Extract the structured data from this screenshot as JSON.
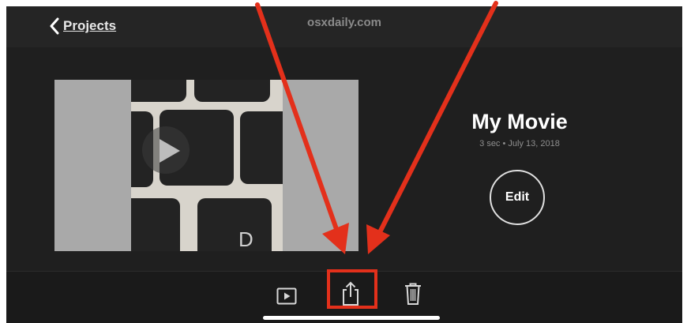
{
  "header": {
    "back_label": "Projects",
    "site": "osxdaily.com"
  },
  "project": {
    "title": "My Movie",
    "meta": "3 sec • July 13, 2018",
    "edit_label": "Edit",
    "thumbnail_keys": [
      "D"
    ]
  },
  "toolbar": {
    "items": [
      {
        "name": "play-icon"
      },
      {
        "name": "share-icon",
        "highlighted": true
      },
      {
        "name": "trash-icon"
      }
    ]
  },
  "annotation": {
    "arrow_color": "#e3301b"
  }
}
